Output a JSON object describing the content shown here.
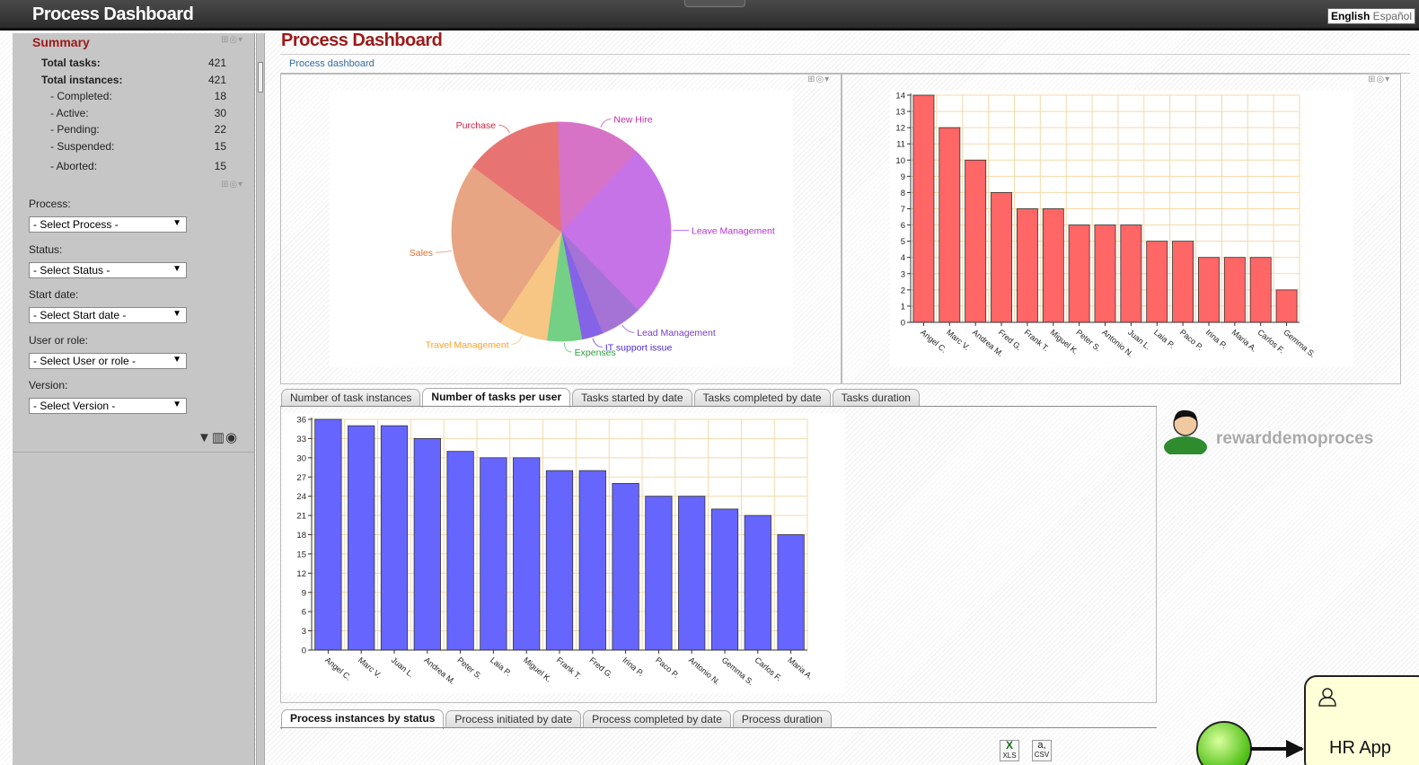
{
  "app": {
    "title": "Process Dashboard"
  },
  "languages": {
    "current": "English",
    "other": "Español"
  },
  "summary": {
    "title": "Summary",
    "rows": [
      {
        "label": "Total tasks:",
        "value": "421",
        "style": "bold"
      },
      {
        "label": "Total instances:",
        "value": "421",
        "style": "bold"
      },
      {
        "label": "- Completed:",
        "value": "18",
        "style": "indent"
      },
      {
        "label": "- Active:",
        "value": "30",
        "style": "indent"
      },
      {
        "label": "- Pending:",
        "value": "22",
        "style": "indent"
      },
      {
        "label": "- Suspended:",
        "value": "15",
        "style": "indent"
      },
      {
        "label": "- Aborted:",
        "value": "15",
        "style": "indent"
      }
    ]
  },
  "filters": [
    {
      "label": "Process:",
      "selected": "- Select Process -"
    },
    {
      "label": "Status:",
      "selected": "- Select Status -"
    },
    {
      "label": "Start date:",
      "selected": "- Select Start date -"
    },
    {
      "label": "User or role:",
      "selected": "- Select User or role -"
    },
    {
      "label": "Version:",
      "selected": "- Select Version -"
    }
  ],
  "filter_tools": {
    "filter_icon": "funnel-icon",
    "clear_icon": "trash-icon",
    "refresh_icon": "refresh-icon"
  },
  "main": {
    "title": "Process Dashboard",
    "breadcrumb": "Process dashboard"
  },
  "tabs_tasks": [
    {
      "label": "Number of task instances",
      "active": false
    },
    {
      "label": "Number of tasks per user",
      "active": true
    },
    {
      "label": "Tasks started by date",
      "active": false
    },
    {
      "label": "Tasks completed by date",
      "active": false
    },
    {
      "label": "Tasks duration",
      "active": false
    }
  ],
  "tabs_instances": [
    {
      "label": "Process instances by status",
      "active": true
    },
    {
      "label": "Process initiated by date",
      "active": false
    },
    {
      "label": "Process completed by date",
      "active": false
    },
    {
      "label": "Process duration",
      "active": false
    }
  ],
  "export": {
    "xls_icon": "excel-export-icon",
    "csv_icon": "csv-export-icon",
    "xls_label": "XLS",
    "csv_label": "CSV"
  },
  "bpm": {
    "process_name": "rewarddemoproces",
    "task_name": "HR App"
  },
  "colors": {
    "pie_palette": [
      "#cc77ee",
      "#aa77dd",
      "#8866ee",
      "#77d688",
      "#ffcc88",
      "#eeaa88",
      "#ee7777",
      "#dd77cc"
    ],
    "bar_red": "#ff6666",
    "bar_blue": "#6666ff",
    "title_red": "#9b1a1a"
  },
  "chart_data": [
    {
      "type": "pie",
      "title": "",
      "categories": [
        "Leave Management",
        "Lead Management",
        "IT support issue",
        "Expenses",
        "Travel Management",
        "Sales",
        "Purchase",
        "New Hire"
      ],
      "values": [
        25,
        6,
        3,
        5,
        7,
        25,
        14,
        12
      ]
    },
    {
      "type": "bar",
      "title": "",
      "categories": [
        "Angel C.",
        "Marc V.",
        "Andrea M.",
        "Fred G.",
        "Frank T.",
        "Miguel K.",
        "Peter S.",
        "Antonio N.",
        "Juan L.",
        "Laia P.",
        "Paco P.",
        "Irina P.",
        "Maria A.",
        "Carlos F.",
        "Gemma S."
      ],
      "values": [
        14,
        12,
        10,
        8,
        7,
        7,
        6,
        6,
        6,
        5,
        5,
        4,
        4,
        4,
        2
      ],
      "ylim": [
        0,
        14
      ],
      "yticks": [
        0,
        1,
        2,
        3,
        4,
        5,
        6,
        7,
        8,
        9,
        10,
        11,
        12,
        13,
        14
      ],
      "grid": true
    },
    {
      "type": "bar",
      "title": "",
      "categories": [
        "Angel C.",
        "Marc V.",
        "Juan L.",
        "Andrea M.",
        "Peter S.",
        "Laia P.",
        "Miguel K.",
        "Frank T.",
        "Fred G.",
        "Irina P.",
        "Paco P.",
        "Antonio N.",
        "Gemma S.",
        "Carlos F.",
        "Maria A."
      ],
      "values": [
        36,
        35,
        35,
        33,
        31,
        30,
        30,
        28,
        28,
        26,
        24,
        24,
        22,
        21,
        18
      ],
      "ylim": [
        0,
        36
      ],
      "yticks": [
        0,
        3,
        6,
        9,
        12,
        15,
        18,
        21,
        24,
        27,
        30,
        33,
        36
      ],
      "grid": true
    }
  ]
}
